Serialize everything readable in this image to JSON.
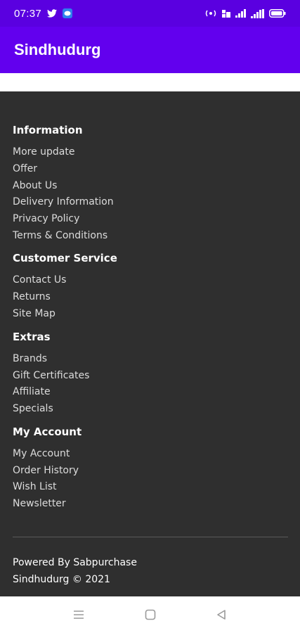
{
  "status_bar": {
    "time": "07:37",
    "icons_left": [
      "twitter-icon",
      "chat-app-icon"
    ],
    "icons_right": [
      "hotspot-icon",
      "data-icon",
      "signal-icon",
      "signal-icon-2",
      "battery-icon"
    ]
  },
  "app_bar": {
    "title": "Sindhudurg",
    "color": "#6200ee"
  },
  "footer": {
    "background": "#2f2f2f",
    "sections": [
      {
        "title": "Information",
        "links": [
          "More update",
          "Offer",
          "About Us",
          "Delivery Information",
          "Privacy Policy",
          "Terms & Conditions"
        ]
      },
      {
        "title": "Customer Service",
        "links": [
          "Contact Us",
          "Returns",
          "Site Map"
        ]
      },
      {
        "title": "Extras",
        "links": [
          "Brands",
          "Gift Certificates",
          "Affiliate",
          "Specials"
        ]
      },
      {
        "title": "My Account",
        "links": [
          "My Account",
          "Order History",
          "Wish List",
          "Newsletter"
        ]
      }
    ],
    "powered_by_label": "Powered By",
    "powered_by_link": "Sabpurchase",
    "copyright": "Sindhudurg © 2021"
  },
  "nav_bar": {
    "buttons": [
      "menu-icon",
      "home-icon",
      "back-icon"
    ]
  }
}
